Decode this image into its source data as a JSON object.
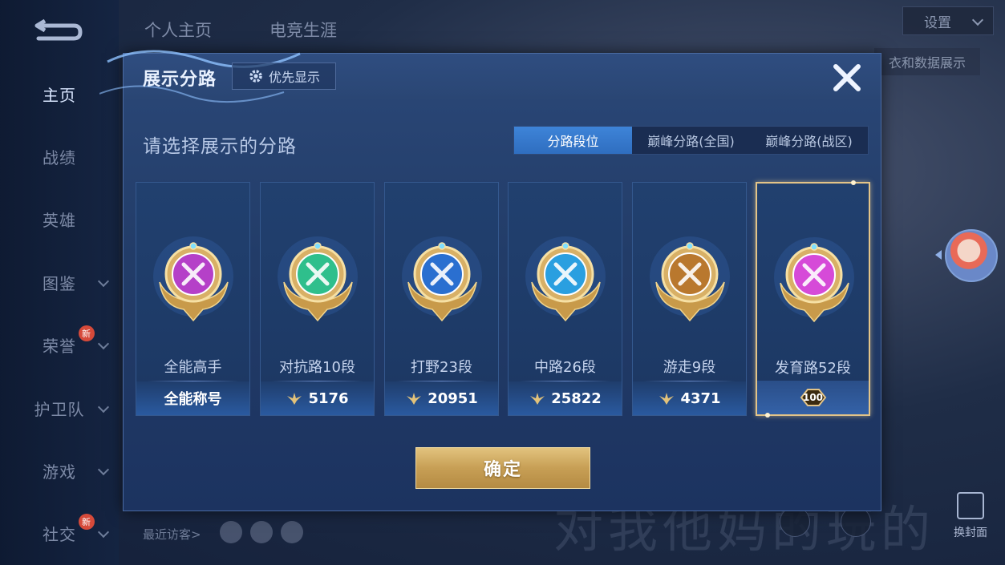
{
  "background": {
    "nav": {
      "items": [
        {
          "label": "主页",
          "active": true,
          "chevron": false,
          "badge": ""
        },
        {
          "label": "战绩",
          "active": false,
          "chevron": false,
          "badge": ""
        },
        {
          "label": "英雄",
          "active": false,
          "chevron": false,
          "badge": ""
        },
        {
          "label": "图鉴",
          "active": false,
          "chevron": true,
          "badge": ""
        },
        {
          "label": "荣誉",
          "active": false,
          "chevron": true,
          "badge": "新"
        },
        {
          "label": "护卫队",
          "active": false,
          "chevron": true,
          "badge": ""
        },
        {
          "label": "游戏",
          "active": false,
          "chevron": true,
          "badge": ""
        },
        {
          "label": "社交",
          "active": false,
          "chevron": true,
          "badge": "新"
        }
      ]
    },
    "top_tabs": [
      "个人主页",
      "电竞生涯"
    ],
    "settings_label": "设置",
    "data_display_label": "衣和数据展示",
    "recent_visitors_label": "最近访客>",
    "watermark_text": "对我他妈的玩的",
    "change_cover_label": "换封面"
  },
  "modal": {
    "title": "展示分路",
    "priority_label": "优先显示",
    "instruction": "请选择展示的分路",
    "tabs": [
      {
        "label": "分路段位",
        "active": true
      },
      {
        "label": "巅峰分路(全国)",
        "active": false
      },
      {
        "label": "巅峰分路(战区)",
        "active": false
      }
    ],
    "cards": [
      {
        "name": "全能高手",
        "footer": "全能称号",
        "has_icon": false,
        "selected": false,
        "emblem": "allround-emblem-icon",
        "color": "#b540c8"
      },
      {
        "name": "对抗路10段",
        "footer": "5176",
        "has_icon": true,
        "selected": false,
        "emblem": "clash-lane-emblem-icon",
        "color": "#2fbf8c"
      },
      {
        "name": "打野23段",
        "footer": "20951",
        "has_icon": true,
        "selected": false,
        "emblem": "jungle-emblem-icon",
        "color": "#2a6fd0"
      },
      {
        "name": "中路26段",
        "footer": "25822",
        "has_icon": true,
        "selected": false,
        "emblem": "mid-lane-emblem-icon",
        "color": "#2a9fe0"
      },
      {
        "name": "游走9段",
        "footer": "4371",
        "has_icon": true,
        "selected": false,
        "emblem": "roam-emblem-icon",
        "color": "#b9782e"
      },
      {
        "name": "发育路52段",
        "footer": "100",
        "has_icon": false,
        "selected": true,
        "emblem": "farm-lane-emblem-icon",
        "color": "#d64ad8"
      }
    ],
    "confirm_label": "确定"
  },
  "colors": {
    "accent_blue": "#3e84d8",
    "gold": "#c79f55",
    "selected_border": "#e3c488"
  }
}
